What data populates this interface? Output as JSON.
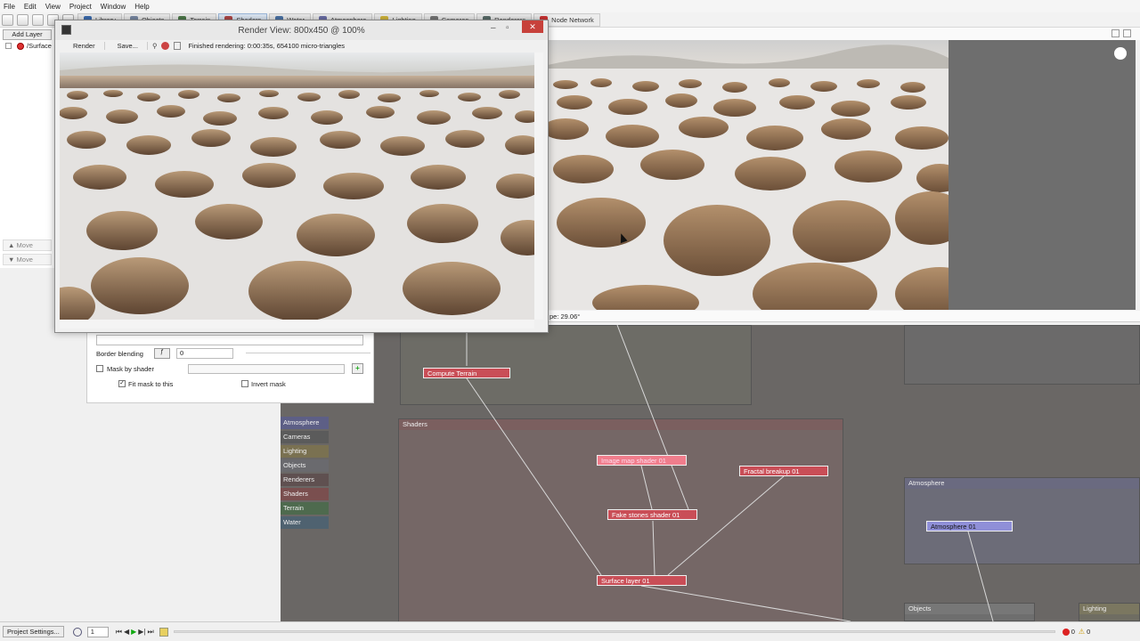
{
  "menu": [
    "File",
    "Edit",
    "View",
    "Project",
    "Window",
    "Help"
  ],
  "toolbar_tabs": [
    {
      "label": "Library",
      "color": "#3b6cb0"
    },
    {
      "label": "Objects",
      "color": "#7a8aa5"
    },
    {
      "label": "Terrain",
      "color": "#4d7a4a"
    },
    {
      "label": "Shaders",
      "color": "#b04848"
    },
    {
      "label": "Water",
      "color": "#4b74a8"
    },
    {
      "label": "Atmosphere",
      "color": "#6b6fa8"
    },
    {
      "label": "Lighting",
      "color": "#d4b83c"
    },
    {
      "label": "Cameras",
      "color": "#777"
    },
    {
      "label": "Renderers",
      "color": "#5a6d6a"
    },
    {
      "label": "Node Network",
      "color": "#cc3333"
    }
  ],
  "left": {
    "add_layer": "Add Layer",
    "layer": "/Surface",
    "move_up": "Move",
    "move_down": "Move"
  },
  "render_view": {
    "title": "Render View: 800x450 @ 100%",
    "render_btn": "Render",
    "save_btn": "Save...",
    "status": "Finished rendering: 0:00:35s, 654100 micro-triangles"
  },
  "viewport_status": "pe: 29.06°",
  "props": {
    "border_blending_label": "Border blending",
    "border_value": "0",
    "mask_by_shader": "Mask by shader",
    "fit_mask": "Fit mask to this",
    "invert_mask": "Invert mask"
  },
  "categories": [
    {
      "label": "Atmosphere",
      "color": "#5d5f86"
    },
    {
      "label": "Cameras",
      "color": "#5b5b5b"
    },
    {
      "label": "Lighting",
      "color": "#7a7151"
    },
    {
      "label": "Objects",
      "color": "#6a6a6e"
    },
    {
      "label": "Renderers",
      "color": "#5f5050"
    },
    {
      "label": "Shaders",
      "color": "#7a4f4f"
    },
    {
      "label": "Terrain",
      "color": "#4e6a4e"
    },
    {
      "label": "Water",
      "color": "#4f6270"
    }
  ],
  "groups": {
    "shaders": "Shaders",
    "atmosphere": "Atmosphere",
    "objects": "Objects",
    "lighting": "Lighting"
  },
  "nodes": {
    "compute_terrain": "Compute Terrain",
    "image_map": "Image map shader 01",
    "fractal": "Fractal breakup 01",
    "fake_stones": "Fake stones shader 01",
    "surface_layer": "Surface layer 01",
    "atmosphere": "Atmosphere 01"
  },
  "bottom": {
    "project_settings": "Project Settings...",
    "frame": "1",
    "errors": "0",
    "warnings": "0"
  }
}
